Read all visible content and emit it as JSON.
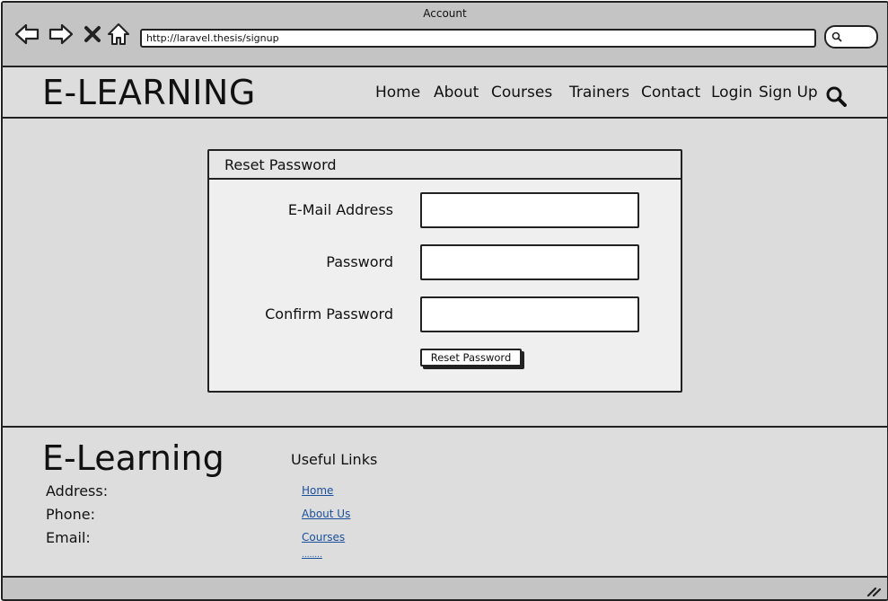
{
  "window": {
    "title": "Account"
  },
  "browser": {
    "url": "http://laravel.thesis/signup",
    "icons": [
      "back-arrow-icon",
      "forward-arrow-icon",
      "close-icon",
      "home-icon",
      "search-icon"
    ]
  },
  "header": {
    "brand": "E-LEARNING",
    "menu": [
      "Home",
      "About",
      "Courses",
      "Trainers",
      "Contact",
      "Login",
      "Sign Up"
    ]
  },
  "form": {
    "title": "Reset Password",
    "fields": [
      {
        "label": "E-Mail Address",
        "value": ""
      },
      {
        "label": "Password",
        "value": ""
      },
      {
        "label": "Confirm Password",
        "value": ""
      }
    ],
    "submit_label": "Reset Password"
  },
  "footer": {
    "brand": "E-Learning",
    "address_label": "Address:",
    "phone_label": "Phone:",
    "email_label": "Email:",
    "links_title": "Useful Links",
    "links": [
      "Home",
      "About Us",
      "Courses",
      "........"
    ]
  },
  "colors": {
    "chrome": "#c4c4c4",
    "page_bg": "#dcdcdc",
    "card_bg": "#efefef",
    "link": "#1a4f9c"
  }
}
